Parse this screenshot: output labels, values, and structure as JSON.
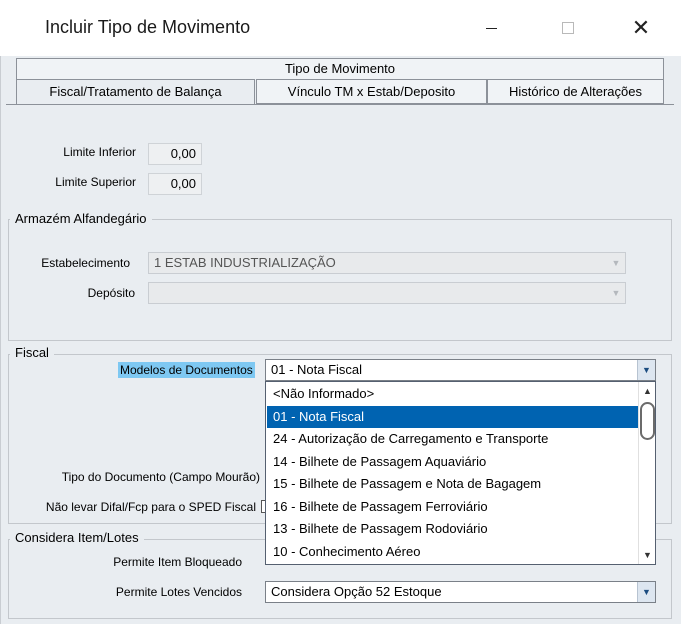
{
  "window": {
    "title": "Incluir Tipo de Movimento",
    "close_glyph": "✕"
  },
  "tabs": {
    "top": "Tipo de Movimento",
    "fiscal": "Fiscal/Tratamento de Balança",
    "vinculo": "Vínculo TM x Estab/Deposito",
    "historico": "Histórico de Alterações"
  },
  "limites": {
    "inferior_label": "Limite Inferior",
    "inferior_value": "0,00",
    "superior_label": "Limite Superior",
    "superior_value": "0,00"
  },
  "armazem": {
    "title": "Armazém Alfandegário",
    "estabelecimento_label": "Estabelecimento",
    "estabelecimento_value": "1 ESTAB INDUSTRIALIZAÇÃO",
    "deposito_label": "Depósito",
    "deposito_value": ""
  },
  "fiscal": {
    "title": "Fiscal",
    "modelos_label": "Modelos de Documentos",
    "modelos_value": "01 - Nota Fiscal",
    "tipo_doc_label": "Tipo do Documento (Campo Mourão)",
    "difal_label": "Não levar Difal/Fcp para o SPED Fiscal"
  },
  "dropdown": {
    "options": [
      "<Não Informado>",
      "01 - Nota Fiscal",
      "24 - Autorização de Carregamento e Transporte",
      "14 - Bilhete de Passagem Aquaviário",
      "15 - Bilhete de Passagem e Nota de Bagagem",
      "16 - Bilhete de Passagem Ferroviário",
      "13 - Bilhete de Passagem Rodoviário",
      "10 - Conhecimento Aéreo"
    ],
    "selected_index": 1
  },
  "considera": {
    "title": "Considera Item/Lotes",
    "item_bloqueado_label": "Permite Item Bloqueado",
    "lotes_vencidos_label": "Permite Lotes Vencidos",
    "lotes_vencidos_value": "Considera Opção 52 Estoque"
  },
  "icons": {
    "dropdown_arrow": "▼",
    "scroll_up": "▲",
    "scroll_down": "▼"
  },
  "colors": {
    "selection": "#0063b1",
    "label_highlight": "#7ec8f2",
    "background": "#e9edf1"
  }
}
